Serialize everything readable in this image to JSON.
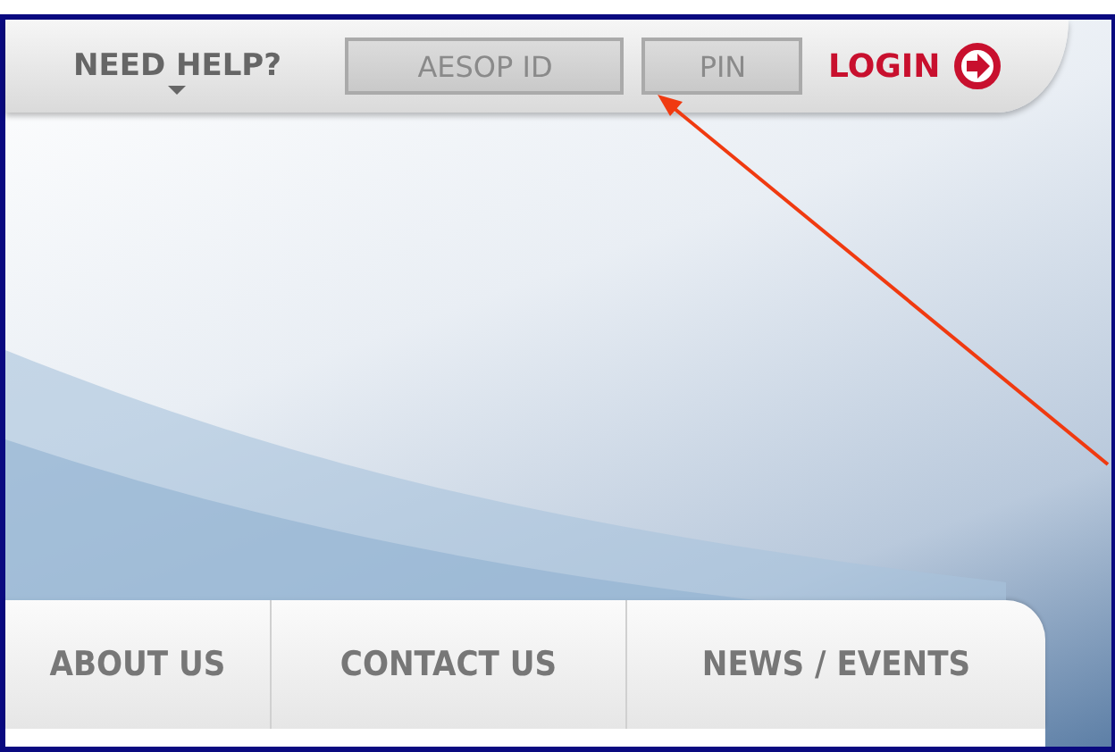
{
  "top_bar": {
    "help_label": "NEED HELP?",
    "aesop_id": {
      "placeholder": "AESOP ID"
    },
    "pin": {
      "placeholder": "PIN"
    },
    "login_label": "LOGIN"
  },
  "nav": {
    "items": [
      {
        "label": "ABOUT US"
      },
      {
        "label": "CONTACT US"
      },
      {
        "label": "NEWS / EVENTS"
      }
    ]
  }
}
